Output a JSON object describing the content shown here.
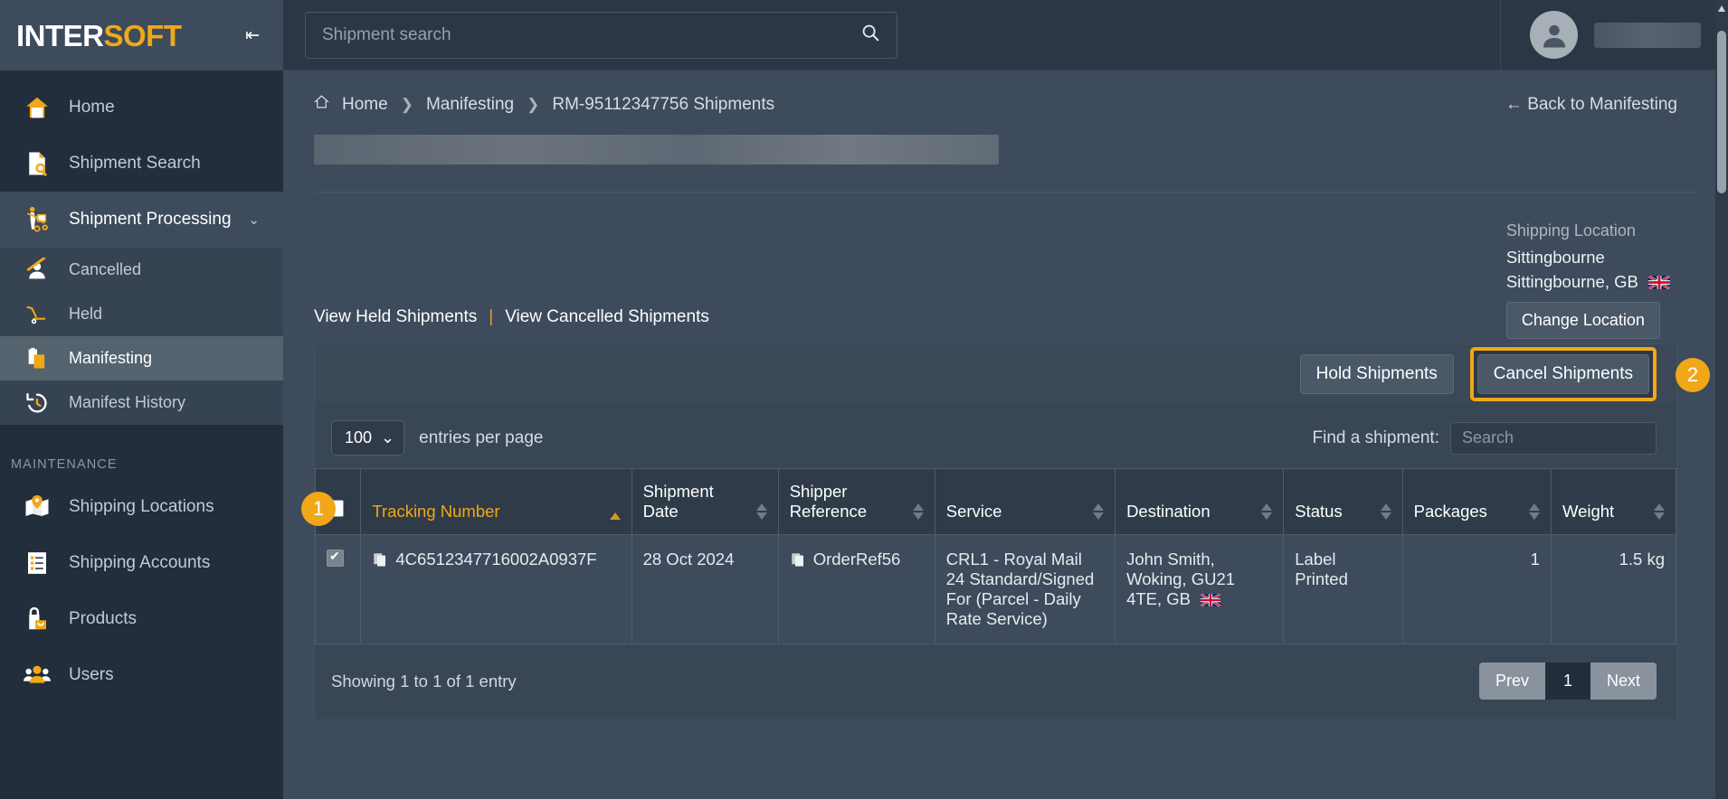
{
  "brand": {
    "name_white": "IN",
    "name_white2": "TER",
    "name_orange": "SOFT",
    "collapse_icon": "collapse-icon"
  },
  "search": {
    "placeholder": "Shipment search",
    "value": "",
    "icon": "search-icon"
  },
  "user": {
    "avatar": "user-avatar-icon",
    "name_redacted": ""
  },
  "sidebar": {
    "items": [
      {
        "label": "Home",
        "icon": "home-icon"
      },
      {
        "label": "Shipment Search",
        "icon": "document-search-icon"
      },
      {
        "label": "Shipment Processing",
        "icon": "hand-truck-icon",
        "chevron": "⌄"
      }
    ],
    "submenu": [
      {
        "label": "Cancelled",
        "icon": "person-cancelled-icon",
        "active": false
      },
      {
        "label": "Held",
        "icon": "hand-truck-empty-icon",
        "active": false
      },
      {
        "label": "Manifesting",
        "icon": "clipboard-icon",
        "active": true
      },
      {
        "label": "Manifest History",
        "icon": "history-clock-icon",
        "active": false
      }
    ],
    "section_label": "MAINTENANCE",
    "maintenance": [
      {
        "label": "Shipping Locations",
        "icon": "map-pin-icon"
      },
      {
        "label": "Shipping Accounts",
        "icon": "list-icon"
      },
      {
        "label": "Products",
        "icon": "shopping-bag-icon"
      },
      {
        "label": "Users",
        "icon": "users-icon"
      }
    ]
  },
  "breadcrumb": {
    "home_icon": "home-icon",
    "items": [
      "Home",
      "Manifesting",
      "RM-95112347756 Shipments"
    ],
    "separator": "❯"
  },
  "back_link": {
    "label": "Back to Manifesting",
    "arrow": "←"
  },
  "location": {
    "title": "Shipping Location",
    "name": "Sittingbourne",
    "address": "Sittingbourne, GB",
    "flag": "gb-flag-icon",
    "change_button": "Change Location"
  },
  "view_links": {
    "held": "View Held Shipments",
    "divider": "|",
    "cancelled": "View Cancelled Shipments"
  },
  "actions": {
    "hold": "Hold Shipments",
    "cancel": "Cancel Shipments"
  },
  "annotations": {
    "one": "1",
    "two": "2"
  },
  "table_controls": {
    "per_page_value": "100",
    "per_page_chevron": "⌄",
    "per_page_label": "entries per page",
    "find_label": "Find a shipment:",
    "find_placeholder": "Search",
    "find_value": ""
  },
  "table": {
    "columns": [
      {
        "label": "",
        "key": "select"
      },
      {
        "label": "Tracking Number",
        "sorted": true,
        "dir": "asc"
      },
      {
        "label": "Shipment Date"
      },
      {
        "label": "Shipper Reference"
      },
      {
        "label": "Service"
      },
      {
        "label": "Destination"
      },
      {
        "label": "Status"
      },
      {
        "label": "Packages"
      },
      {
        "label": "Weight"
      }
    ],
    "rows": [
      {
        "checked": true,
        "tracking_number": "4C6512347716002A0937F",
        "shipment_date": "28 Oct 2024",
        "shipper_reference": "OrderRef56",
        "service": "CRL1 - Royal Mail 24 Standard/Signed For (Parcel - Daily Rate Service)",
        "destination": "John Smith, Woking, GU21 4TE, GB",
        "destination_flag": "gb-flag-icon",
        "status": "Label Printed",
        "packages": "1",
        "weight": "1.5 kg"
      }
    ]
  },
  "footer": {
    "showing": "Showing 1 to 1 of 1 entry",
    "prev": "Prev",
    "page": "1",
    "next": "Next"
  },
  "colors": {
    "accent": "#f0a818",
    "sidebar_bg": "#222e3c",
    "main_bg": "#3d4b5c",
    "panel_bg": "#384655",
    "header_bg": "#2f3b49"
  }
}
